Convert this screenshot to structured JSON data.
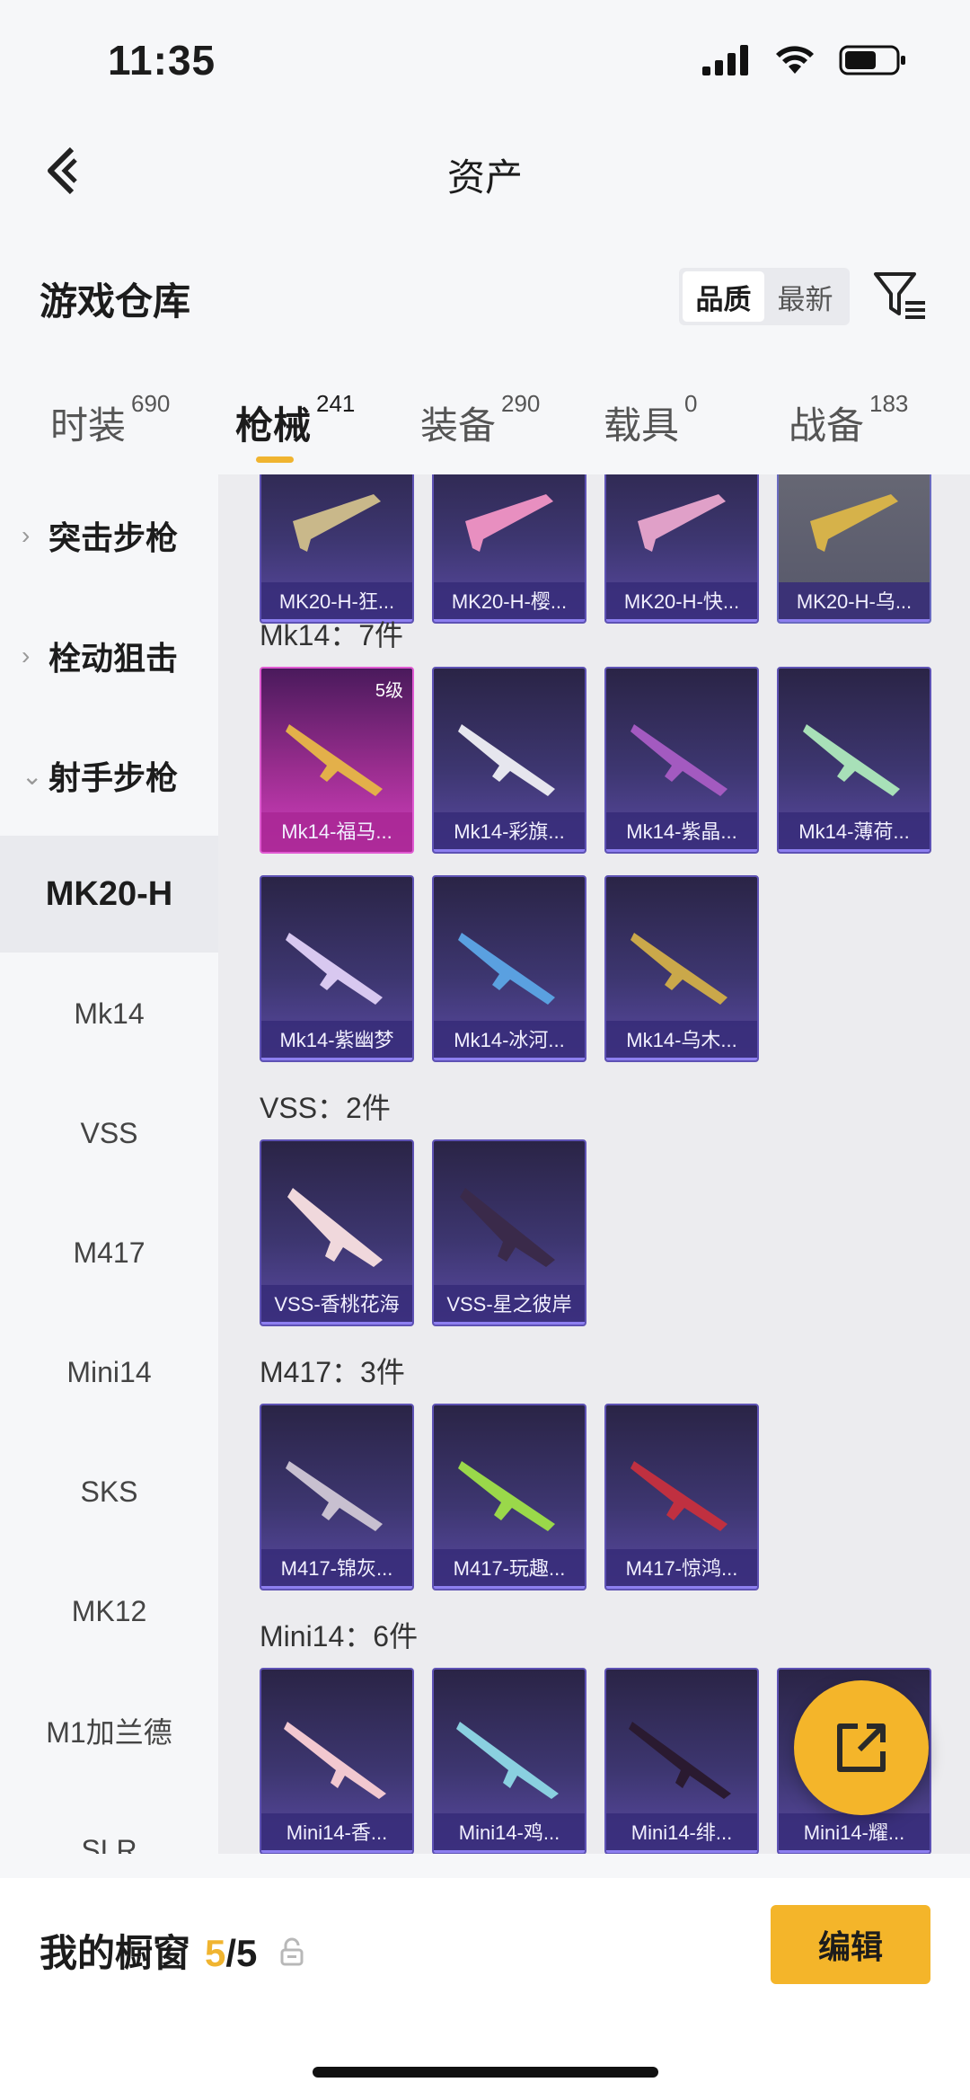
{
  "status_bar": {
    "time": "11:35"
  },
  "nav": {
    "title": "资产"
  },
  "warehouse": {
    "title": "游戏仓库",
    "sort_quality": "品质",
    "sort_latest": "最新"
  },
  "tabs": [
    {
      "label": "时装",
      "count": "690"
    },
    {
      "label": "枪械",
      "count": "241"
    },
    {
      "label": "装备",
      "count": "290"
    },
    {
      "label": "载具",
      "count": "0"
    },
    {
      "label": "战备",
      "count": "183"
    }
  ],
  "sidebar": {
    "groups": [
      "突击步枪",
      "栓动狙击",
      "射手步枪"
    ],
    "items": [
      "MK20-H",
      "Mk14",
      "VSS",
      "M417",
      "Mini14",
      "SKS",
      "MK12",
      "M1加兰德",
      "SLR"
    ]
  },
  "content": {
    "top_row": [
      "MK20-H-狂...",
      "MK20-H-樱...",
      "MK20-H-快...",
      "MK20-H-乌..."
    ],
    "sections": [
      {
        "title": "Mk14：7件",
        "items": [
          "Mk14-福马...",
          "Mk14-彩旗...",
          "Mk14-紫晶...",
          "Mk14-薄荷...",
          "Mk14-紫幽梦",
          "Mk14-冰河...",
          "Mk14-乌木..."
        ],
        "level_badge": "5级"
      },
      {
        "title": "VSS：2件",
        "items": [
          "VSS-香桃花海",
          "VSS-星之彼岸"
        ]
      },
      {
        "title": "M417：3件",
        "items": [
          "M417-锦灰...",
          "M417-玩趣...",
          "M417-惊鸿..."
        ]
      },
      {
        "title": "Mini14：6件",
        "items": [
          "Mini14-香...",
          "Mini14-鸡...",
          "Mini14-绯...",
          "Mini14-耀..."
        ]
      }
    ]
  },
  "bottom": {
    "label": "我的橱窗",
    "used": "5",
    "total": "/5",
    "edit": "编辑"
  },
  "colors": {
    "accent": "#f4b52a",
    "card_bg": "#3d3670",
    "card_gold": "#d23fbe"
  }
}
